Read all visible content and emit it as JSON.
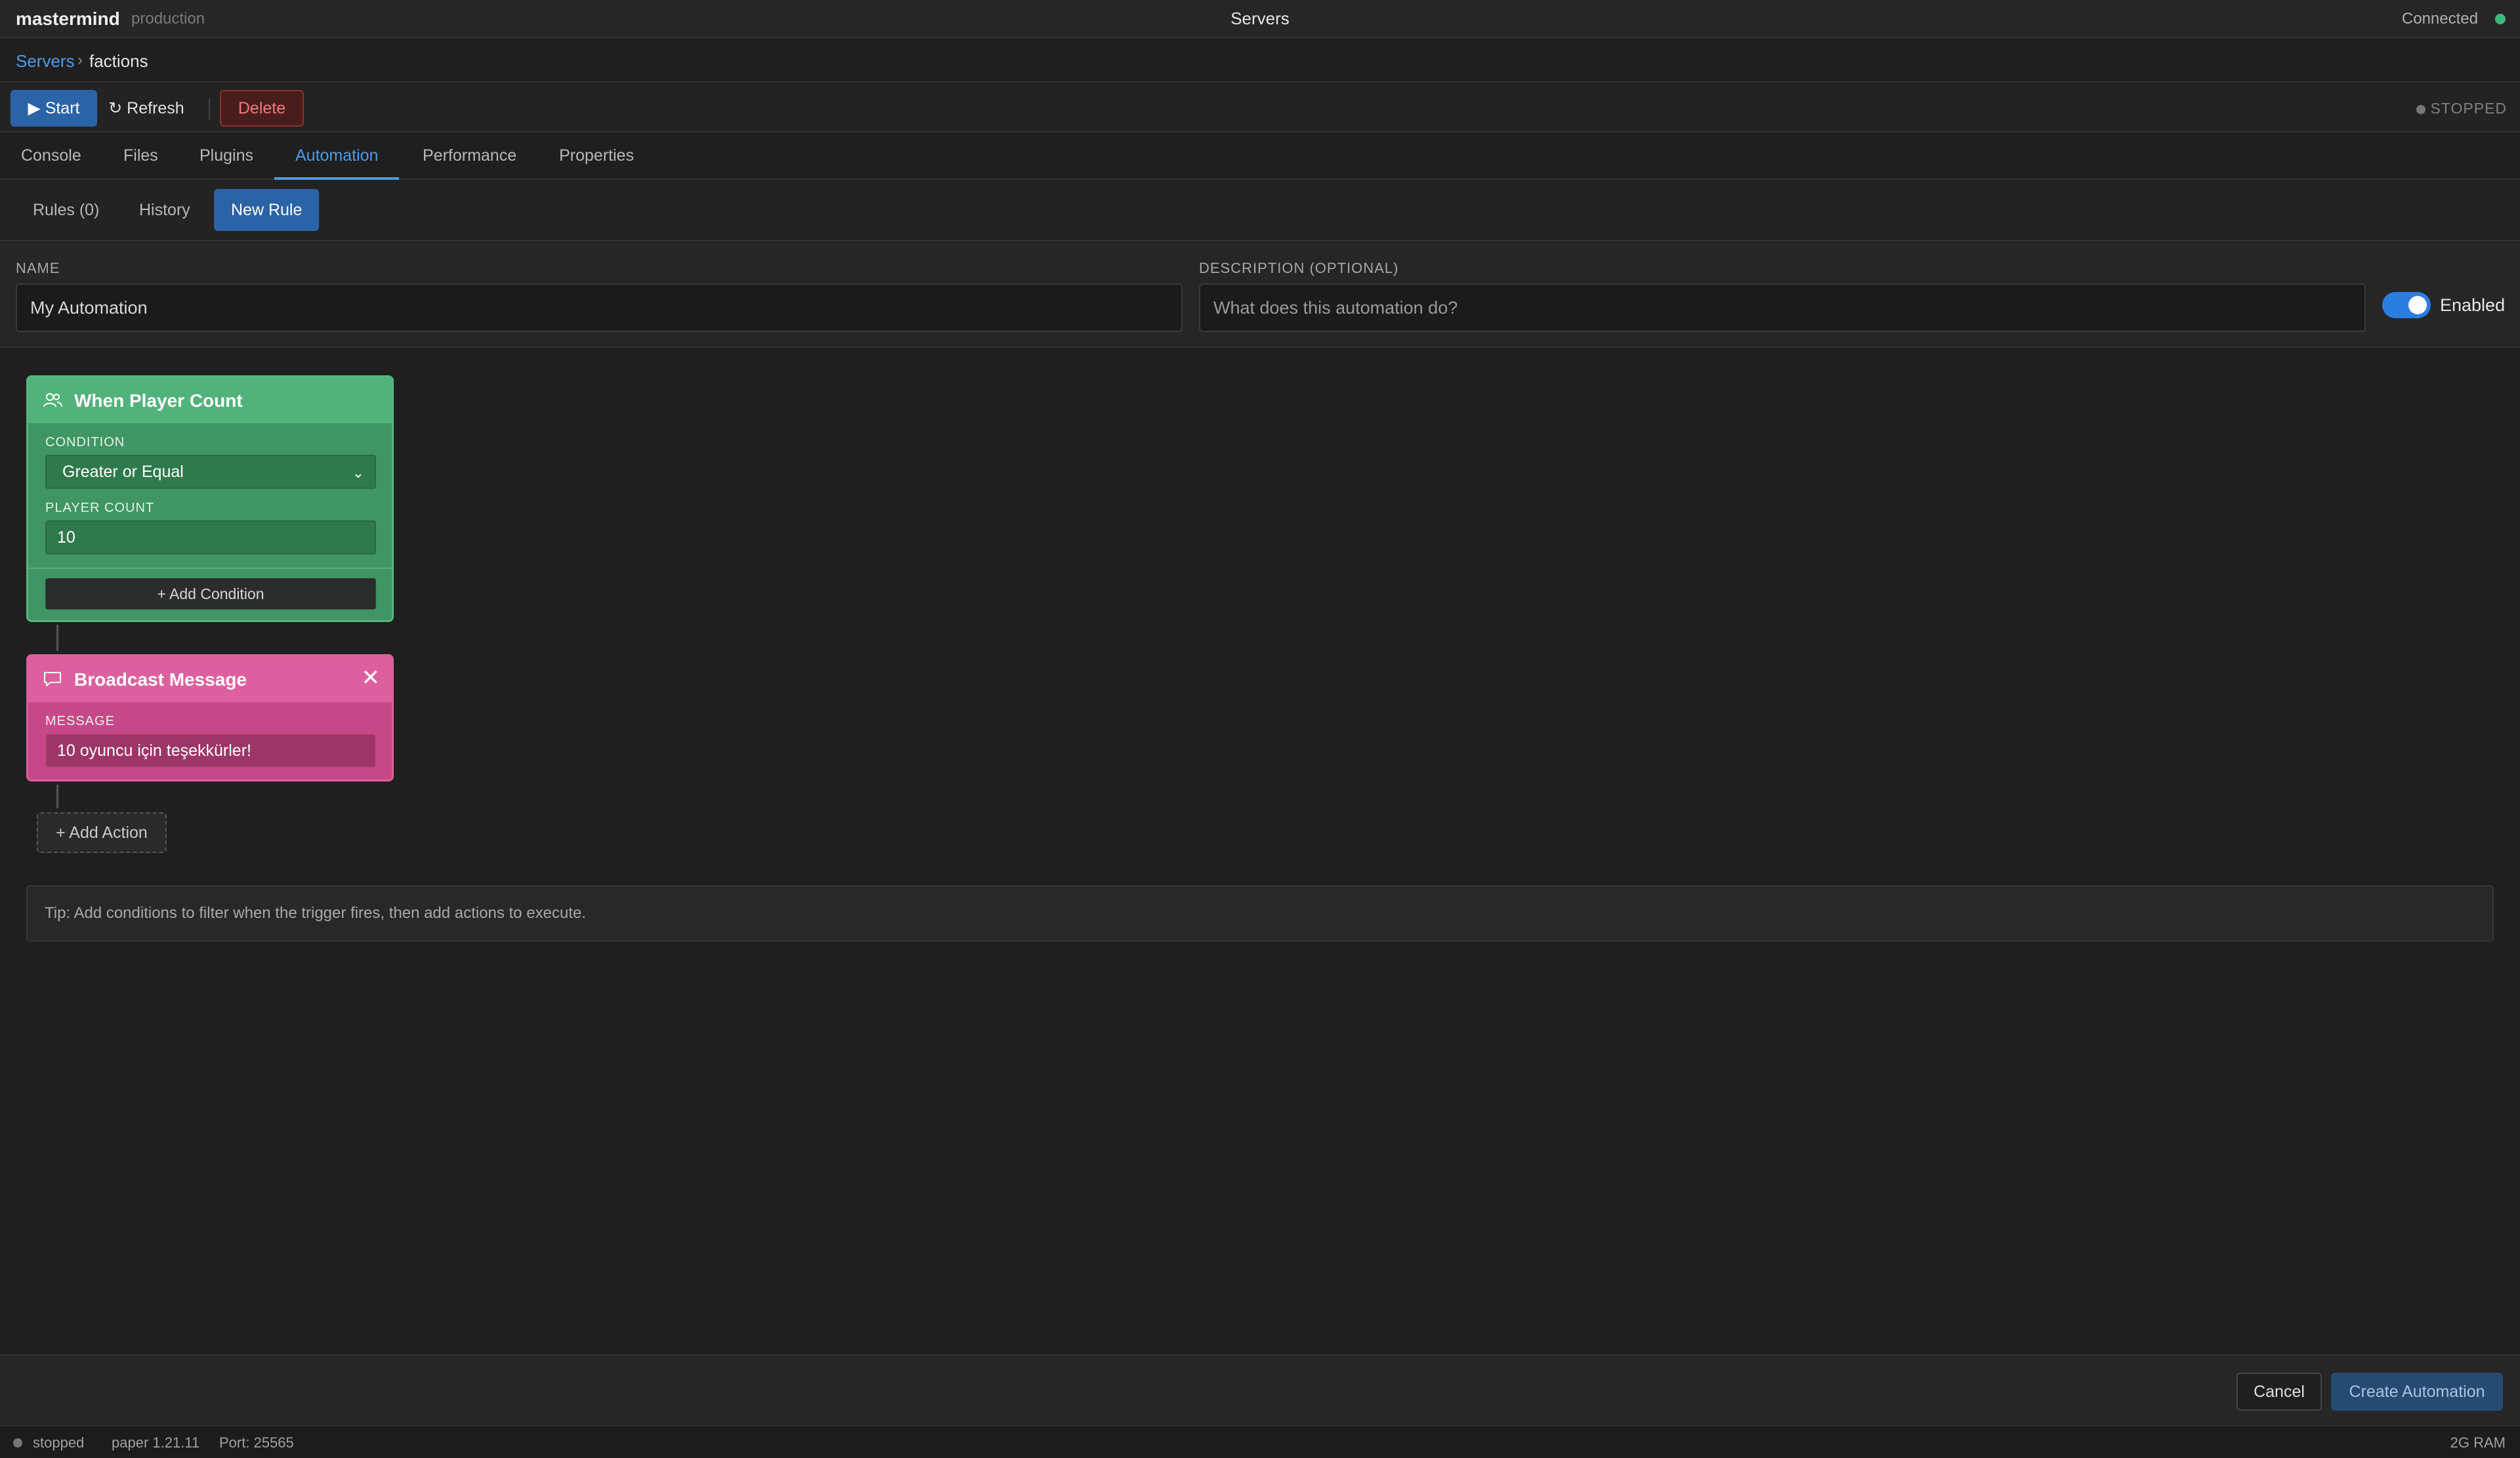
{
  "app": {
    "brand": "mastermind",
    "environment": "production",
    "title": "Servers",
    "connection_status": "Connected",
    "connection_color": "#3fb97a"
  },
  "breadcrumb": {
    "root": "Servers",
    "separator": "›",
    "current": "factions"
  },
  "toolbar": {
    "start_label": "▶ Start",
    "refresh_label": "↻ Refresh",
    "delete_label": "Delete",
    "server_state": "STOPPED"
  },
  "tabs": [
    {
      "label": "Console",
      "active": false
    },
    {
      "label": "Files",
      "active": false
    },
    {
      "label": "Plugins",
      "active": false
    },
    {
      "label": "Automation",
      "active": true
    },
    {
      "label": "Performance",
      "active": false
    },
    {
      "label": "Properties",
      "active": false
    }
  ],
  "subtabs": [
    {
      "label": "Rules (0)",
      "active": false
    },
    {
      "label": "History",
      "active": false
    },
    {
      "label": "New Rule",
      "active": true
    }
  ],
  "form": {
    "name_label": "NAME",
    "name_value": "My Automation",
    "description_label": "DESCRIPTION (OPTIONAL)",
    "description_placeholder": "What does this automation do?",
    "enabled_label": "Enabled",
    "enabled": true
  },
  "trigger": {
    "title": "When Player Count",
    "icon": "users-icon",
    "condition_label": "CONDITION",
    "condition_value": "Greater or Equal",
    "player_count_label": "PLAYER COUNT",
    "player_count_value": "10",
    "add_condition_label": "+ Add Condition",
    "color": "#51b27b"
  },
  "action": {
    "title": "Broadcast Message",
    "icon": "message-icon",
    "close": "✕",
    "message_label": "MESSAGE",
    "message_value": "10 oyuncu için teşekkürler!",
    "color": "#de5f9f"
  },
  "add_action_label": "+ Add Action",
  "tip": "Tip: Add conditions to filter when the trigger fires, then add actions to execute.",
  "footer": {
    "cancel_label": "Cancel",
    "create_label": "Create Automation"
  },
  "statusbar": {
    "state": "stopped",
    "version": "paper 1.21.11",
    "port": "Port: 25565",
    "ram": "2G RAM"
  },
  "colors": {
    "accent": "#2b63a8",
    "link": "#4d9be8",
    "danger": "#8b2f2f"
  }
}
